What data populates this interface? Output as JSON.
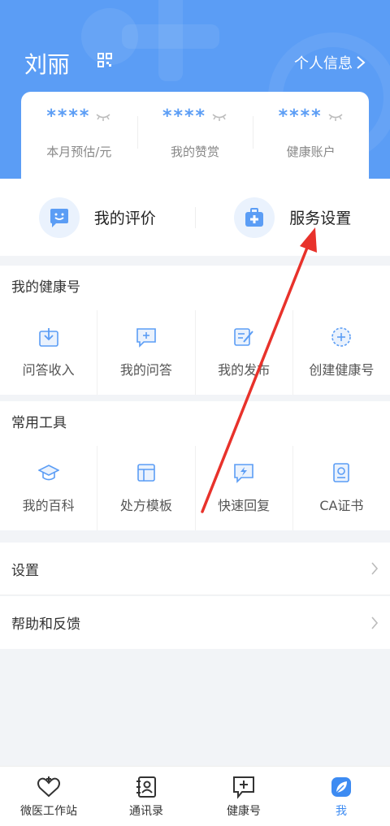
{
  "user": {
    "name": "刘丽",
    "profile_link": "个人信息"
  },
  "stats": [
    {
      "value": "****",
      "label": "本月预估/元"
    },
    {
      "value": "****",
      "label": "我的赞赏"
    },
    {
      "value": "****",
      "label": "健康账户"
    }
  ],
  "eval": {
    "review": "我的评价",
    "service": "服务设置"
  },
  "health": {
    "title": "我的健康号",
    "items": [
      {
        "label": "问答收入",
        "icon": "download-box-icon"
      },
      {
        "label": "我的问答",
        "icon": "add-chat-icon"
      },
      {
        "label": "我的发布",
        "icon": "edit-doc-icon"
      },
      {
        "label": "创建健康号",
        "icon": "add-circle-icon"
      }
    ]
  },
  "tools": {
    "title": "常用工具",
    "items": [
      {
        "label": "我的百科",
        "icon": "grad-cap-icon"
      },
      {
        "label": "处方模板",
        "icon": "template-icon"
      },
      {
        "label": "快速回复",
        "icon": "flash-chat-icon"
      },
      {
        "label": "CA证书",
        "icon": "certificate-icon"
      }
    ]
  },
  "settings": {
    "settings": "设置",
    "help": "帮助和反馈"
  },
  "tabbar": {
    "items": [
      {
        "label": "微医工作站"
      },
      {
        "label": "通讯录"
      },
      {
        "label": "健康号"
      },
      {
        "label": "我"
      }
    ]
  },
  "colors": {
    "primary": "#5b9df5",
    "active_tab": "#3d8bf2",
    "annotation_arrow": "#e8322b"
  }
}
